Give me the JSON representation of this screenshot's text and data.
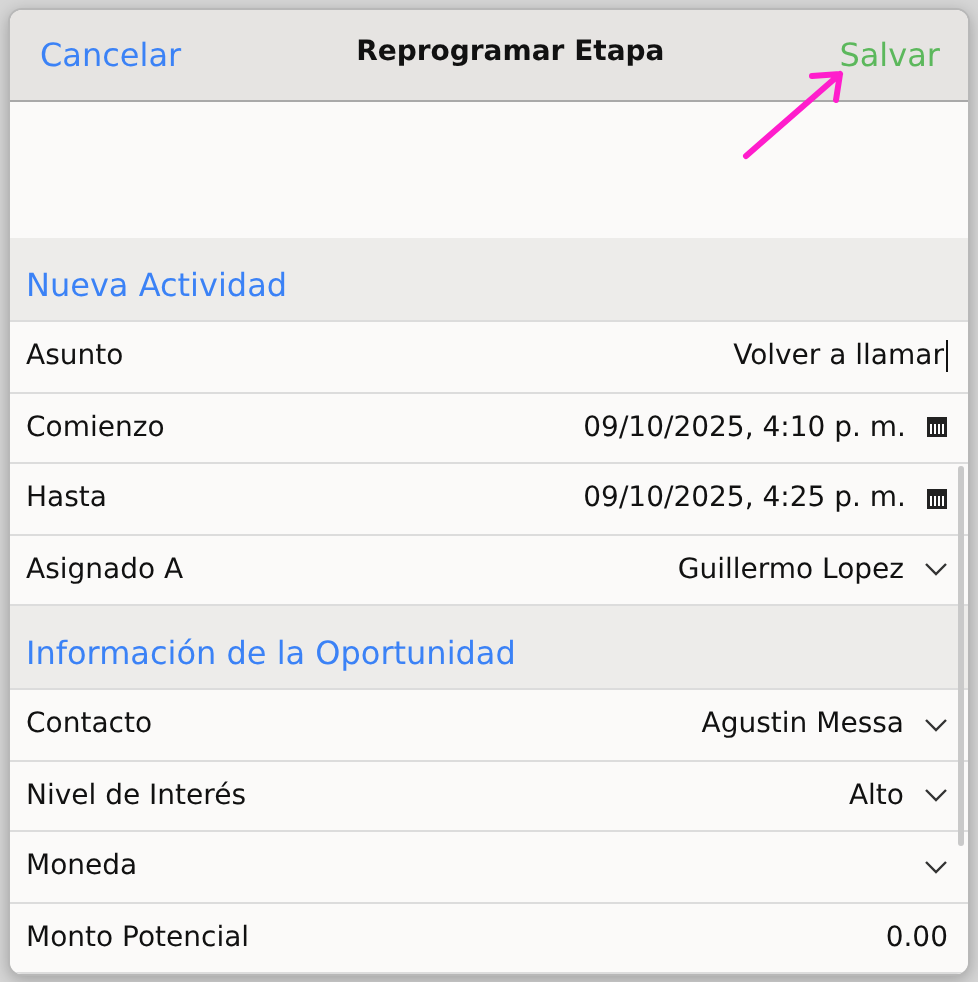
{
  "dialog": {
    "title": "Reprogramar Etapa",
    "cancel": "Cancelar",
    "save": "Salvar"
  },
  "sections": [
    {
      "title": "Nueva Actividad",
      "fields": [
        {
          "kind": "text",
          "label": "Asunto",
          "value": "Volver a llamar",
          "focused": true
        },
        {
          "kind": "date",
          "label": "Comienzo",
          "value": "09/10/2025, 4:10 p. m."
        },
        {
          "kind": "date",
          "label": "Hasta",
          "value": "09/10/2025, 4:25 p. m."
        },
        {
          "kind": "select",
          "label": "Asignado A",
          "value": "Guillermo Lopez"
        }
      ]
    },
    {
      "title": "Información de la Oportunidad",
      "fields": [
        {
          "kind": "select",
          "label": "Contacto",
          "value": "Agustin Messa"
        },
        {
          "kind": "select",
          "label": "Nivel de Interés",
          "value": "Alto"
        },
        {
          "kind": "select",
          "label": "Moneda"
        },
        {
          "kind": "number",
          "label": "Monto Potencial",
          "value": "0.00"
        }
      ]
    }
  ]
}
